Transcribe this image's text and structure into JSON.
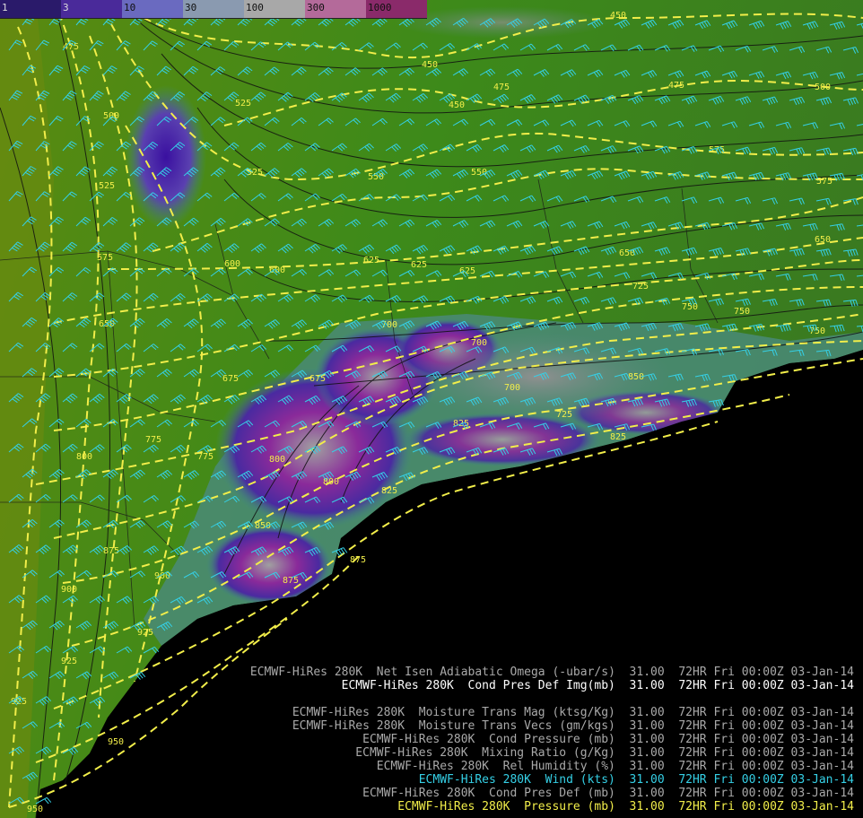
{
  "colorbar": {
    "labels": [
      "1",
      "3",
      "10",
      "30",
      "100",
      "300",
      "1000"
    ],
    "colors": [
      "#2a1a6a",
      "#4a2a9a",
      "#6a6ac0",
      "#8a9ab0",
      "#a8a8a8",
      "#b46a9a",
      "#8a2a6a"
    ]
  },
  "contour_labels": [
    "450",
    "475",
    "500",
    "525",
    "550",
    "575",
    "600",
    "625",
    "650",
    "675",
    "700",
    "725",
    "750",
    "775",
    "800",
    "825",
    "850",
    "875",
    "900",
    "925",
    "950"
  ],
  "legend": {
    "lines": [
      {
        "text": "ECMWF-HiRes 280K  Net Isen Adiabatic Omega (-ubar/s)  31.00  72HR Fri 00:00Z 03-Jan-14",
        "color": "gray"
      },
      {
        "text": "ECMWF-HiRes 280K  Cond Pres Def Img(mb)  31.00  72HR Fri 00:00Z 03-Jan-14",
        "color": "white"
      },
      {
        "text": "",
        "color": "gray"
      },
      {
        "text": "ECMWF-HiRes 280K  Moisture Trans Mag (ktsg/Kg)  31.00  72HR Fri 00:00Z 03-Jan-14",
        "color": "gray"
      },
      {
        "text": "ECMWF-HiRes 280K  Moisture Trans Vecs (gm/kgs)  31.00  72HR Fri 00:00Z 03-Jan-14",
        "color": "gray"
      },
      {
        "text": "ECMWF-HiRes 280K  Cond Pressure (mb)  31.00  72HR Fri 00:00Z 03-Jan-14",
        "color": "gray"
      },
      {
        "text": "ECMWF-HiRes 280K  Mixing Ratio (g/Kg)  31.00  72HR Fri 00:00Z 03-Jan-14",
        "color": "gray"
      },
      {
        "text": "ECMWF-HiRes 280K  Rel Humidity (%)  31.00  72HR Fri 00:00Z 03-Jan-14",
        "color": "gray"
      },
      {
        "text": "ECMWF-HiRes 280K  Wind (kts)  31.00  72HR Fri 00:00Z 03-Jan-14",
        "color": "cyan"
      },
      {
        "text": "ECMWF-HiRes 280K  Cond Pres Def (mb)  31.00  72HR Fri 00:00Z 03-Jan-14",
        "color": "gray"
      },
      {
        "text": "ECMWF-HiRes 280K  Pressure (mb)  31.00  72HR Fri 00:00Z 03-Jan-14",
        "color": "yellow"
      }
    ]
  }
}
